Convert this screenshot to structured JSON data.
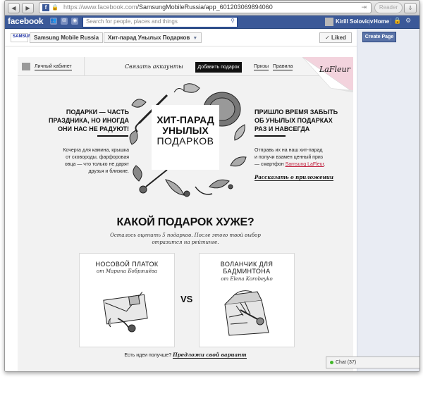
{
  "browser": {
    "url_host": "https://www.facebook.com",
    "url_path": "/SamsungMobileRussia/app_601203069894060",
    "reader_label": "Reader",
    "back_icon": "back-arrow-icon",
    "forward_icon": "forward-arrow-icon"
  },
  "facebook": {
    "logo": "facebook",
    "search_placeholder": "Search for people, places and things",
    "user_name": "Kirill Soloviov",
    "home_label": "Home",
    "brand_color": "#3b5998"
  },
  "page_header": {
    "samsung_tag": "SAMSUNG",
    "page_name": "Samsung Mobile Russia",
    "app_name": "Хит-парад Унылых Подарков",
    "liked_label": "✓ Liked"
  },
  "right_column": {
    "create_page": "Create Page"
  },
  "app_nav": {
    "cabinet": "Личный кабинет",
    "link_account": "Связать аккаунты",
    "add_gift": "Добавить подарок",
    "prizes": "Призы",
    "rules": "Правила",
    "brand": "LaFleur"
  },
  "left_block": {
    "heading_1": "ПОДАРКИ — ЧАСТЬ",
    "heading_2": "ПРАЗДНИКА, НО ИНОГДА",
    "heading_3": "ОНИ НАС НЕ РАДУЮТ!",
    "desc_1": "Кочерга для камина, крышка",
    "desc_2": "от сковороды, фарфоровая",
    "desc_3": "овца — что только не дарят",
    "desc_4": "друзья и близкие."
  },
  "title_box": {
    "line1": "ХИТ-ПАРАД",
    "line2": "УНЫЛЫХ",
    "line3": "ПОДАРКОВ"
  },
  "right_block": {
    "heading_1": "ПРИШЛО ВРЕМЯ ЗАБЫТЬ",
    "heading_2": "ОБ УНЫЛЫХ ПОДАРКАХ",
    "heading_3": "РАЗ И НАВСЕГДА",
    "desc_1": "Отправь их на наш хит-парад",
    "desc_2": "и получи взамен ценный приз",
    "desc_3_prefix": "— смартфон ",
    "desc_3_link": "Samsung LaFleur",
    "desc_3_suffix": ".",
    "tell_link": "Рассказать о приложении"
  },
  "vote": {
    "question": "КАКОЙ ПОДАРОК ХУЖЕ?",
    "sub_1": "Осталось оценить 5 подарков. После этого твой выбор",
    "sub_2": "отразится на рейтинге.",
    "vs": "VS",
    "card_a_title": "НОСОВОЙ ПЛАТОК",
    "card_a_author": "от Марина Бобряшёва",
    "card_b_title_1": "ВОЛАНЧИК ДЛЯ",
    "card_b_title_2": "БАДМИНТОНА",
    "card_b_author": "от Elena Korobeyko",
    "ideas_prefix": "Есть идеи получше? ",
    "ideas_link": "Предложи свой вариант"
  },
  "chat": {
    "label": "Chat (37)"
  }
}
